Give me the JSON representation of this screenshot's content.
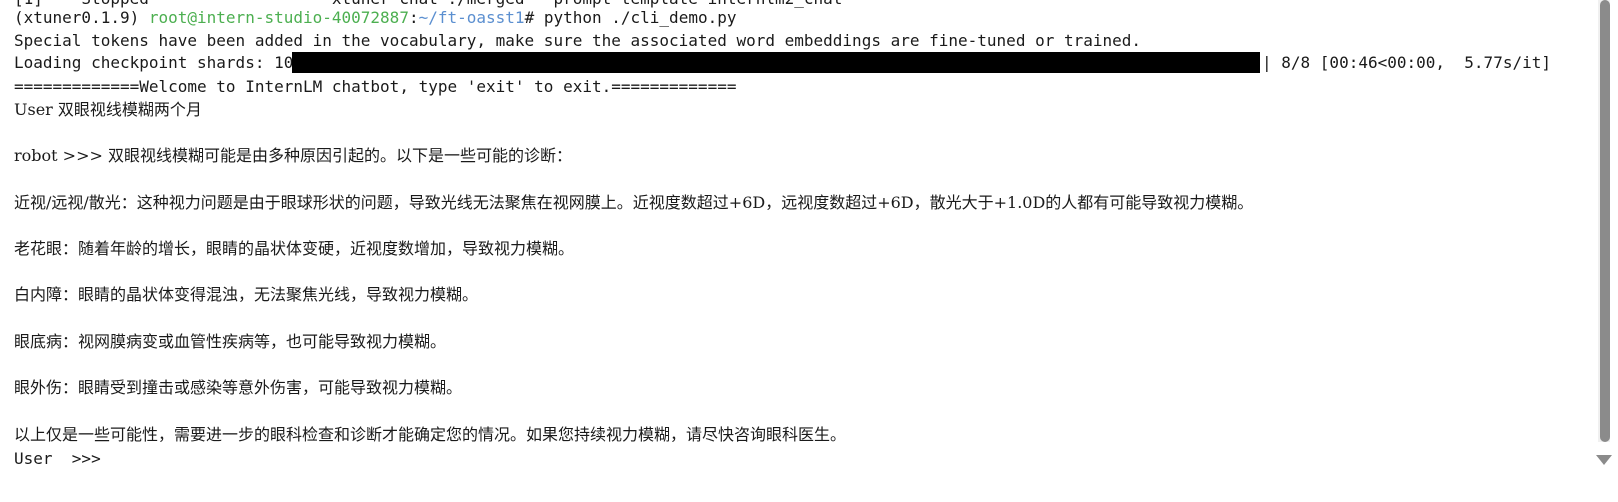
{
  "terminal": {
    "cut_top_line": "[1]    Stopped                   xtuner chat ./merged --prompt-template internlm2_chat",
    "prompt": {
      "env": "(xtuner0.1.9) ",
      "user_host": "root@intern-studio-40072887",
      "sep": ":",
      "path": "~/ft-oasst1",
      "symbol": "# ",
      "command": "python ./cli_demo.py"
    },
    "special_tokens": "Special tokens have been added in the vocabulary, make sure the associated word embeddings are fine-tuned or trained.",
    "loading": {
      "label": "Loading checkpoint shards: 100%|",
      "progress": 1.0,
      "tail": "| 8/8 [00:46<00:00,  5.77s/it]"
    },
    "welcome": "=============Welcome to InternLM chatbot, type 'exit' to exit.=============",
    "user_line": "User 双眼视线模糊两个月",
    "robot_line": "robot >>> 双眼视线模糊可能是由多种原因引起的。以下是一些可能的诊断：",
    "answers": [
      "近视/远视/散光：这种视力问题是由于眼球形状的问题，导致光线无法聚焦在视网膜上。近视度数超过+6D，远视度数超过+6D，散光大于+1.0D的人都有可能导致视力模糊。",
      "老花眼：随着年龄的增长，眼睛的晶状体变硬，近视度数增加，导致视力模糊。",
      "白内障：眼睛的晶状体变得混浊，无法聚焦光线，导致视力模糊。",
      "眼底病：视网膜病变或血管性疾病等，也可能导致视力模糊。",
      "眼外伤：眼睛受到撞击或感染等意外伤害，可能导致视力模糊。",
      "以上仅是一些可能性，需要进一步的眼科检查和诊断才能确定您的情况。如果您持续视力模糊，请尽快咨询眼科医生。"
    ],
    "user_prompt": "User  >>>"
  },
  "colors": {
    "user_host": "#4caf50",
    "path": "#5b8fd0",
    "progress_bar": "#000000",
    "scroll_thumb": "#8b8b8b"
  },
  "icons": {
    "scroll_down": "chevron-down-icon"
  }
}
